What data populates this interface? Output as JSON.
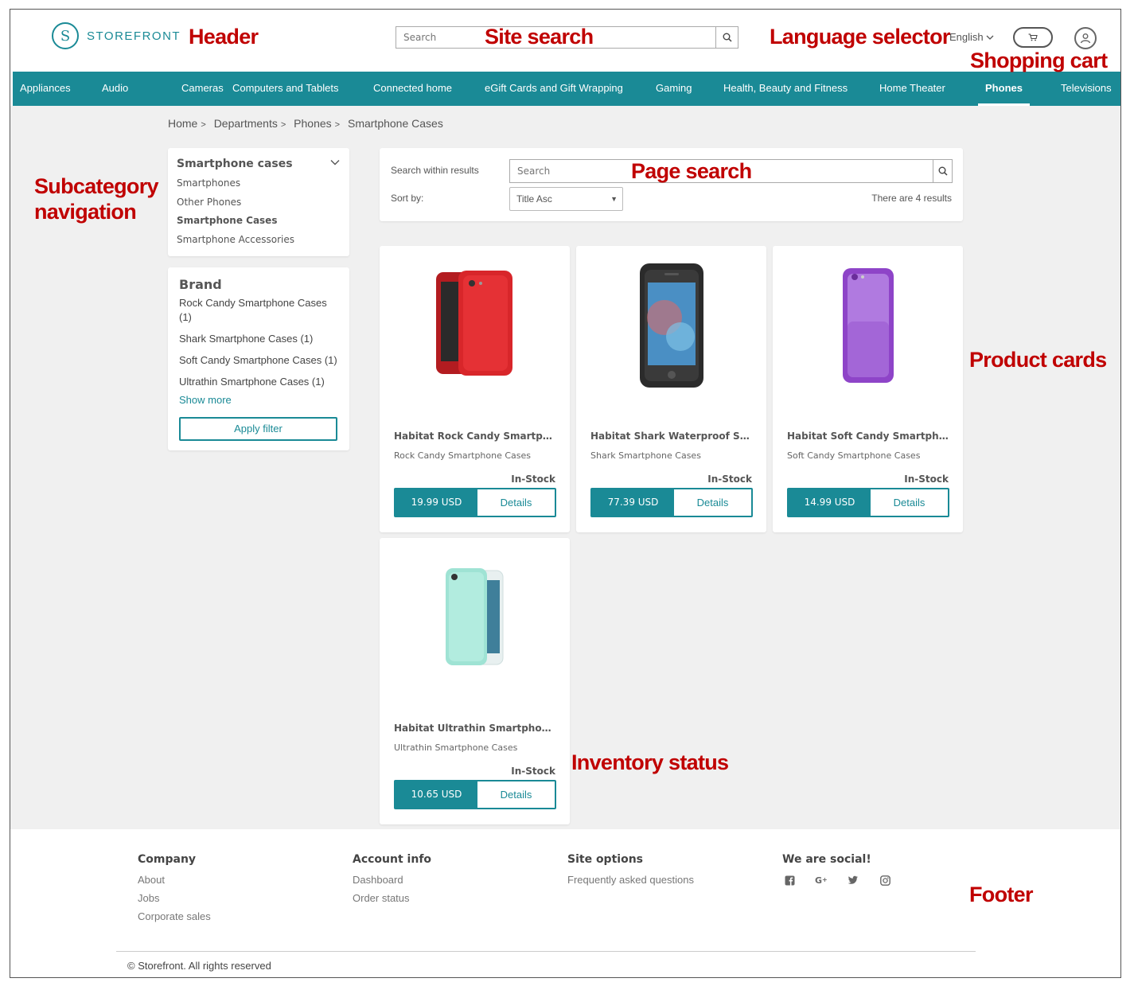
{
  "header": {
    "logo_text": "STOREFRONT",
    "search_placeholder": "Search",
    "language": "English"
  },
  "nav": {
    "items": [
      {
        "label": "Appliances",
        "active": false
      },
      {
        "label": "Audio",
        "active": false
      },
      {
        "label": "Cameras",
        "active": false
      },
      {
        "label": "Computers and Tablets",
        "active": false
      },
      {
        "label": "Connected home",
        "active": false
      },
      {
        "label": "eGift Cards and Gift Wrapping",
        "active": false
      },
      {
        "label": "Gaming",
        "active": false
      },
      {
        "label": "Health, Beauty and Fitness",
        "active": false
      },
      {
        "label": "Home Theater",
        "active": false
      },
      {
        "label": "Phones",
        "active": true
      },
      {
        "label": "Televisions",
        "active": false
      }
    ]
  },
  "breadcrumb": [
    "Home",
    "Departments",
    "Phones",
    "Smartphone Cases"
  ],
  "subcategories": {
    "title": "Smartphone cases",
    "items": [
      {
        "label": "Smartphones",
        "selected": false
      },
      {
        "label": "Other Phones",
        "selected": false
      },
      {
        "label": "Smartphone Cases",
        "selected": true
      },
      {
        "label": "Smartphone Accessories",
        "selected": false
      }
    ]
  },
  "brand_filter": {
    "title": "Brand",
    "options": [
      "Rock Candy Smartphone Cases (1)",
      "Shark Smartphone Cases (1)",
      "Soft Candy Smartphone Cases (1)",
      "Ultrathin Smartphone Cases (1)"
    ],
    "show_more": "Show more",
    "apply": "Apply filter"
  },
  "results": {
    "search_label": "Search within results",
    "search_placeholder": "Search",
    "sort_label": "Sort by:",
    "sort_value": "Title Asc",
    "count_text": "There are 4 results"
  },
  "products": [
    {
      "name": "Habitat Rock Candy Smartpho...",
      "category": "Rock Candy Smartphone Cases",
      "stock": "In-Stock",
      "price": "19.99 USD",
      "details": "Details",
      "color": "#d8262a"
    },
    {
      "name": "Habitat Shark Waterproof Sm...",
      "category": "Shark Smartphone Cases",
      "stock": "In-Stock",
      "price": "77.39 USD",
      "details": "Details",
      "color": "#2a2a2a"
    },
    {
      "name": "Habitat Soft Candy Smartphon...",
      "category": "Soft Candy Smartphone Cases",
      "stock": "In-Stock",
      "price": "14.99 USD",
      "details": "Details",
      "color": "#9b59d0"
    },
    {
      "name": "Habitat Ultrathin Smartphone...",
      "category": "Ultrathin Smartphone Cases",
      "stock": "In-Stock",
      "price": "10.65 USD",
      "details": "Details",
      "color": "#9fe3d4"
    }
  ],
  "footer": {
    "company": {
      "title": "Company",
      "links": [
        "About",
        "Jobs",
        "Corporate sales"
      ]
    },
    "account": {
      "title": "Account info",
      "links": [
        "Dashboard",
        "Order status"
      ]
    },
    "site": {
      "title": "Site options",
      "links": [
        "Frequently asked questions"
      ]
    },
    "social": {
      "title": "We are social!",
      "icons": [
        "facebook-icon",
        "google-plus-icon",
        "twitter-icon",
        "instagram-icon"
      ]
    },
    "copyright": "© Storefront. All rights reserved"
  },
  "annotations": {
    "header": "Header",
    "site_search": "Site search",
    "language_selector": "Language selector",
    "shopping_cart": "Shopping cart",
    "subcategory_line1": "Subcategory",
    "subcategory_line2": "navigation",
    "page_search": "Page search",
    "product_cards": "Product cards",
    "inventory_status": "Inventory status",
    "footer": "Footer"
  },
  "colors": {
    "accent": "#1a8a96",
    "annotation": "#c00000",
    "background": "#f0f0f0"
  }
}
